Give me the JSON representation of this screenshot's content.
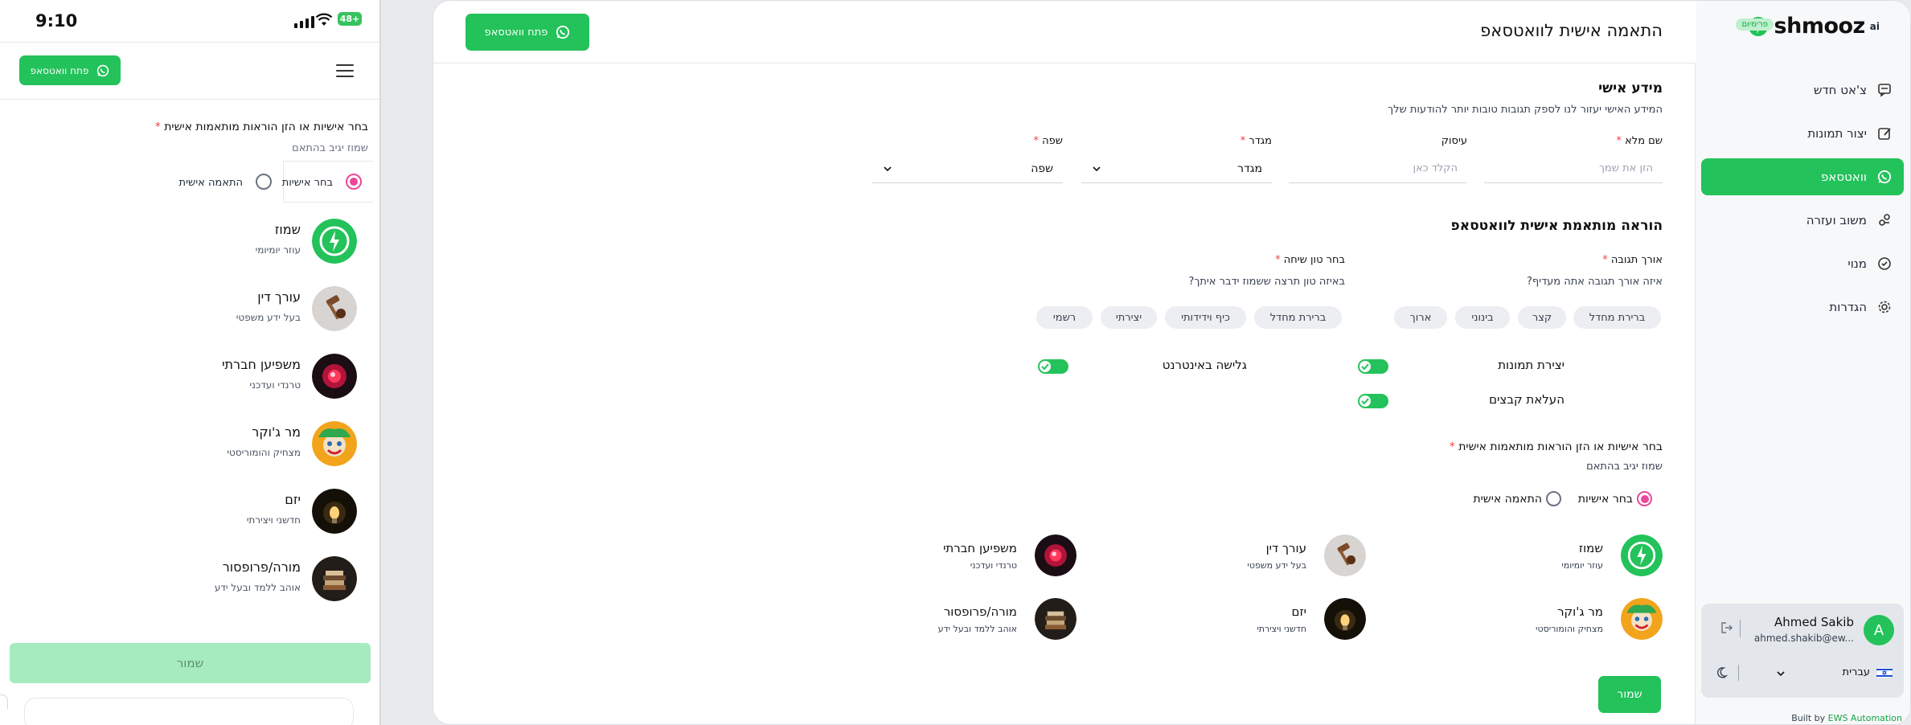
{
  "mobile": {
    "time": "9:10",
    "battery": "48+",
    "whatsapp_button": "פתח וואטסאפ",
    "section_label": "בחר אישיות או הזן הוראות מותאמות אישית",
    "required_mark": "*",
    "hint": "שמוז יגיב בהתאם",
    "radio_persona": "בחר אישיות",
    "radio_custom": "התאמה אישית",
    "personas": [
      {
        "name": "שמוז",
        "desc": "עוזר יומיומי"
      },
      {
        "name": "עורך דין",
        "desc": "בעל ידע משפטי"
      },
      {
        "name": "משפיען חברתי",
        "desc": "טרנדי ועדכני"
      },
      {
        "name": "מר ג'וקר",
        "desc": "מצחיק והומוריסטי"
      },
      {
        "name": "יזם",
        "desc": "חדשני ויצירתי"
      },
      {
        "name": "מורה/פרופסור",
        "desc": "אוהב ללמד ובעל ידע"
      }
    ],
    "save_button": "שמור"
  },
  "sidebar": {
    "logo": "shmooz",
    "logo_ai": "ai",
    "badge": "פרימיום",
    "nav": [
      {
        "label": "צ'אט חדש",
        "icon": "chat-icon"
      },
      {
        "label": "יצור תמונות",
        "icon": "image-edit-icon"
      },
      {
        "label": "וואטסאפ",
        "icon": "whatsapp-icon",
        "active": true
      },
      {
        "label": "משוב ועזרה",
        "icon": "feedback-icon"
      },
      {
        "label": "מנוי",
        "icon": "check-badge-icon"
      },
      {
        "label": "הגדרות",
        "icon": "gear-icon"
      }
    ],
    "user": {
      "initial": "A",
      "name": "Ahmed Sakib",
      "email": "ahmed.shakib@ew..."
    },
    "language": "עברית",
    "built_by_prefix": "Built by",
    "built_by_link": "EWS Automation"
  },
  "topbar": {
    "title": "התאמה אישית לוואטסאפ",
    "whatsapp_button": "פתח וואטסאפ"
  },
  "personal": {
    "heading": "מידע אישי",
    "description": "המידע האישי יעזור לנו לספק תגובות טובות יותר להודעות שלך",
    "full_name_label": "שם מלא",
    "full_name_placeholder": "הזן את שמך",
    "occupation_label": "עיסוק",
    "occupation_placeholder": "הקלד כאן",
    "gender_label": "מגדר",
    "gender_value": "מגדר",
    "language_label": "שפה",
    "language_value": "שפה"
  },
  "instructions": {
    "heading": "הוראה מותאמת אישית לוואטסאפ",
    "length_label": "אורך תגובה",
    "length_question": "איזה אורך תגובה אתה מעדיף?",
    "length_options": [
      "ברירת מחדל",
      "קצר",
      "בינוני",
      "ארוך"
    ],
    "tone_label": "בחר טון שיחה",
    "tone_question": "באיזה טון תרצה ששמוז ידבר איתך?",
    "tone_options": [
      "ברירת מחדל",
      "כיף וידידותי",
      "יצירתי",
      "רשמי"
    ],
    "toggles": {
      "images": "יצירת תמונות",
      "files": "העלאת קבצים",
      "web": "גלישה באינטרנט"
    }
  },
  "persona_section": {
    "label": "בחר אישיות או הזן הוראות מותאמות אישית",
    "hint": "שמוז יגיב בהתאם",
    "radio_persona": "בחר אישיות",
    "radio_custom": "התאמה אישית",
    "personas": [
      {
        "name": "שמוז",
        "desc": "עוזר יומיומי"
      },
      {
        "name": "עורך דין",
        "desc": "בעל ידע משפטי"
      },
      {
        "name": "משפיען חברתי",
        "desc": "טרנדי ועדכני"
      },
      {
        "name": "מר ג'וקר",
        "desc": "מצחיק והומוריסטי"
      },
      {
        "name": "יזם",
        "desc": "חדשני ויצירתי"
      },
      {
        "name": "מורה/פרופסור",
        "desc": "אוהב ללמד ובעל ידע"
      }
    ]
  },
  "save_button": "שמור",
  "colors": {
    "accent": "#23c25a",
    "radio": "#ec4899",
    "required": "#ef4444"
  }
}
